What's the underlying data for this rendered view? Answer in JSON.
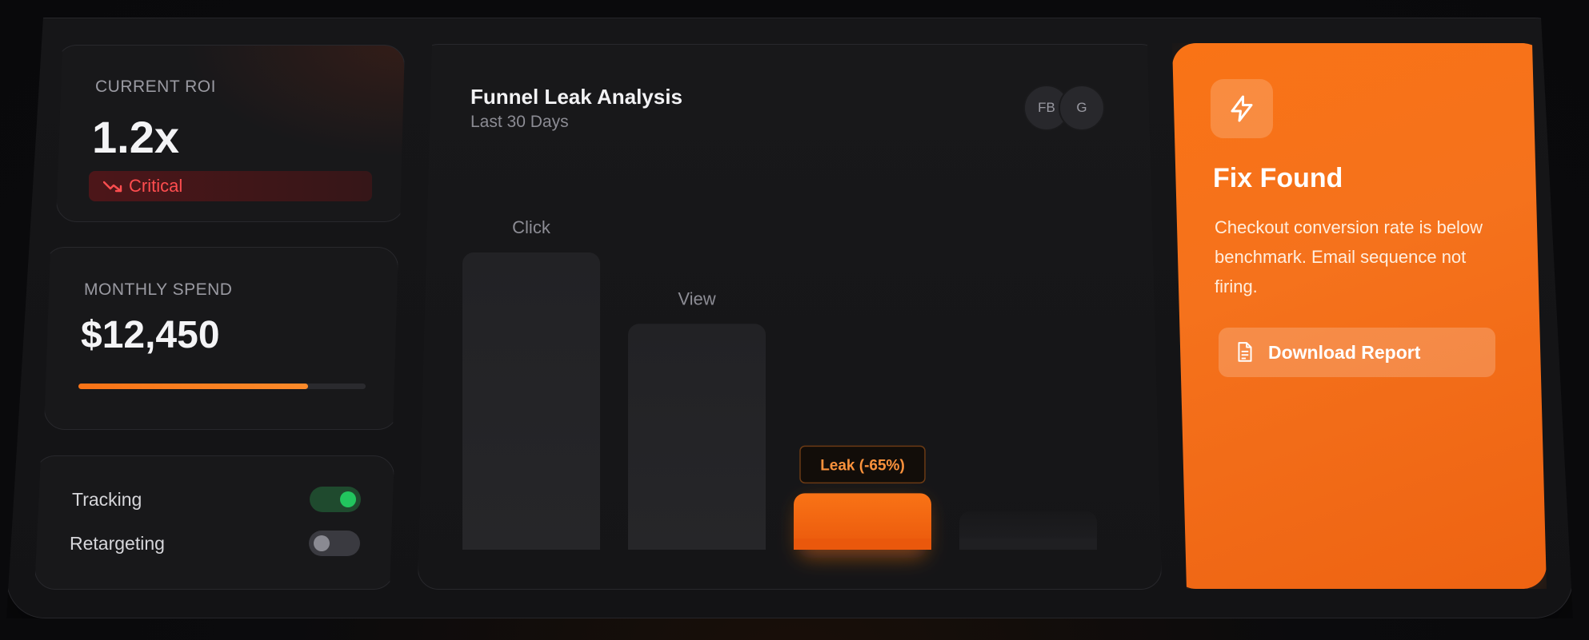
{
  "roi": {
    "label": "CURRENT ROI",
    "value": "1.2x",
    "status": "Critical",
    "status_color": "#ff4d4f"
  },
  "spend": {
    "label": "MONTHLY SPEND",
    "value": "$12,450",
    "progress_fraction": 0.8,
    "accent": "#f97316"
  },
  "toggles": [
    {
      "label": "Tracking",
      "on": true
    },
    {
      "label": "Retargeting",
      "on": false
    }
  ],
  "funnel": {
    "title": "Funnel Leak Analysis",
    "subtitle": "Last 30 Days",
    "avatars": [
      "FB",
      "G"
    ],
    "leak_label": "Leak (-65%)"
  },
  "chart_data": {
    "type": "bar",
    "title": "Funnel Leak Analysis",
    "subtitle": "Last 30 Days",
    "categories": [
      "Click",
      "View",
      "",
      ""
    ],
    "values": [
      100,
      76,
      19,
      13
    ],
    "highlight_index": 2,
    "highlight_color": "#f97316",
    "annotations": [
      {
        "category_index": 2,
        "text": "Leak (-65%)"
      }
    ],
    "ylim": [
      0,
      100
    ],
    "grid": false
  },
  "fix": {
    "icon": "lightning-icon",
    "title": "Fix Found",
    "body": "Checkout conversion rate is below benchmark. Email sequence not firing.",
    "button_icon": "document-icon",
    "button_label": "Download Report"
  }
}
